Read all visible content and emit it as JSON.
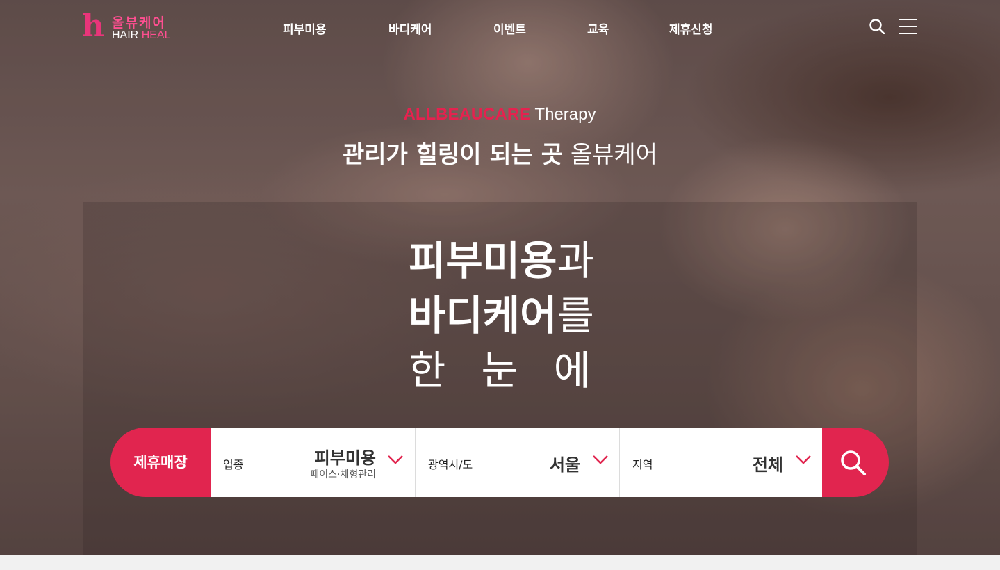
{
  "logo": {
    "mark": "h",
    "korean": "올뷰케어",
    "english_1": "HAIR",
    "english_2": "HEAL"
  },
  "nav": {
    "items": [
      {
        "label": "피부미용"
      },
      {
        "label": "바디케어"
      },
      {
        "label": "이벤트"
      },
      {
        "label": "교육"
      },
      {
        "label": "제휴신청"
      }
    ],
    "search_icon": "search-icon",
    "menu_icon": "hamburger-icon"
  },
  "hero": {
    "eyebrow_brand": "ALLBEAUCARE",
    "eyebrow_word": "Therapy",
    "subtitle_bold": "관리가 힐링이 되는 곳",
    "subtitle_light": "올뷰케어",
    "headline": {
      "line1_bold": "피부미용",
      "line1_light": "과",
      "line2_bold": "바디케어",
      "line2_light": "를",
      "line3_chars": [
        "한",
        "눈",
        "에"
      ]
    }
  },
  "search": {
    "label": "제휴매장",
    "category": {
      "caption": "업종",
      "value": "피부미용",
      "sub": "페이스·체형관리"
    },
    "region": {
      "caption": "광역시/도",
      "value": "서울"
    },
    "area": {
      "caption": "지역",
      "value": "전체"
    },
    "submit_icon": "search-icon"
  },
  "colors": {
    "accent": "#e1254f",
    "logo_pink": "#ff4f91",
    "white": "#ffffff"
  }
}
